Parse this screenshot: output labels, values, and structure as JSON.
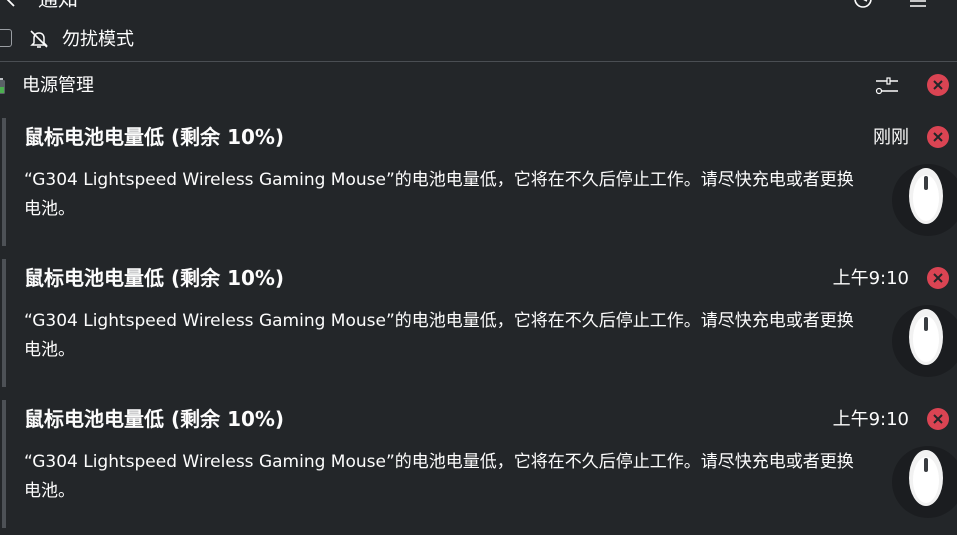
{
  "header": {
    "title": "通知",
    "back_icon": "back-arrow-icon",
    "history_icon": "history-icon",
    "menu_icon": "hamburger-menu-icon"
  },
  "dnd": {
    "label": "勿扰模式",
    "checked": false,
    "icon": "bell-off-icon"
  },
  "group": {
    "title": "电源管理",
    "app_icon": "battery-icon",
    "config_icon": "settings-sliders-icon",
    "close_icon": "close-circle-icon"
  },
  "colors": {
    "background": "#232629",
    "text": "#fcfcfc",
    "close_red": "#da4453",
    "accent_bar": "#4d5156"
  },
  "notifications": [
    {
      "title": "鼠标电池电量低 (剩余 10%)",
      "time": "刚刚",
      "body": "“G304 Lightspeed Wireless Gaming Mouse”的电池电量低，它将在不久后停止工作。请尽快充电或者更换电池。",
      "icon": "mouse-icon"
    },
    {
      "title": "鼠标电池电量低 (剩余 10%)",
      "time": "上午9:10",
      "body": "“G304 Lightspeed Wireless Gaming Mouse”的电池电量低，它将在不久后停止工作。请尽快充电或者更换电池。",
      "icon": "mouse-icon"
    },
    {
      "title": "鼠标电池电量低 (剩余 10%)",
      "time": "上午9:10",
      "body": "“G304 Lightspeed Wireless Gaming Mouse”的电池电量低，它将在不久后停止工作。请尽快充电或者更换电池。",
      "icon": "mouse-icon"
    }
  ]
}
